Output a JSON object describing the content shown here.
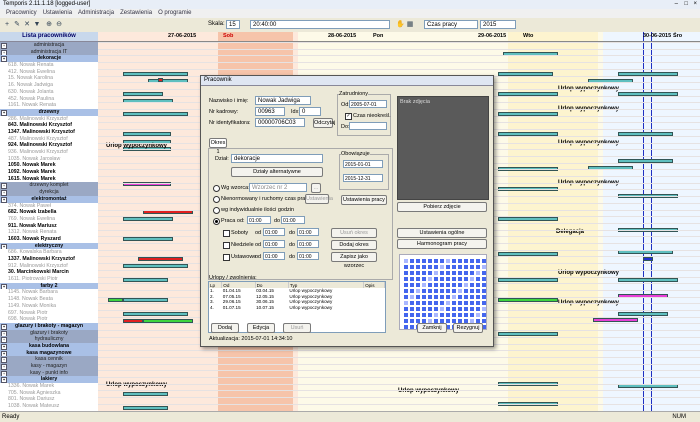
{
  "window": {
    "title": "Temporis 2.11.1.18 [logged-user]"
  },
  "menu": [
    "Pracownicy",
    "Ustawienia",
    "Administracja",
    "Zestawienia",
    "O programie"
  ],
  "toolbar": {
    "skala_label": "Skala:",
    "skala_value": "15",
    "time_value": "20:40:00",
    "view_select": "Czas pracy",
    "year_select": "2015"
  },
  "left_panel": {
    "header": "Lista pracowników",
    "rows": [
      {
        "type": "group",
        "text": "administracja"
      },
      {
        "type": "group",
        "text": "administracja IT"
      },
      {
        "type": "group-blue",
        "text": "dekoracje"
      },
      {
        "type": "dim",
        "text": "618. Nowak Renata"
      },
      {
        "type": "dim",
        "text": "412. Nowak Ewelina"
      },
      {
        "type": "dim",
        "text": "15. Nowak Karolina"
      },
      {
        "type": "dim",
        "text": "16. Nowak Jadwiga"
      },
      {
        "type": "dim",
        "text": "630. Nowak Jolanta"
      },
      {
        "type": "dim",
        "text": "452. Nowak Paulina"
      },
      {
        "type": "dim",
        "text": "1161. Nowak Renata"
      },
      {
        "type": "group-blue",
        "text": "drzewny"
      },
      {
        "type": "dim",
        "text": "286. Malinowski Krzysztof"
      },
      {
        "type": "bold",
        "text": "843. Malinowski Krzysztof"
      },
      {
        "type": "bold",
        "text": "1347. Malinowski Krzysztof"
      },
      {
        "type": "dim",
        "text": "487. Malinowski Krzysztof"
      },
      {
        "type": "bold",
        "text": "924. Malinowski Krzysztof"
      },
      {
        "type": "dim",
        "text": "936. Malinowski Krzysztof"
      },
      {
        "type": "dim",
        "text": "1035. Nowak Jarosław"
      },
      {
        "type": "bold",
        "text": "1050. Nowak Marek"
      },
      {
        "type": "bold",
        "text": "1092. Nowak Marek"
      },
      {
        "type": "bold",
        "text": "1615. Nowak Marek"
      },
      {
        "type": "group",
        "text": "drzewny komplet"
      },
      {
        "type": "group",
        "text": "dyrekcja"
      },
      {
        "type": "group-blue",
        "text": "elektromontaż"
      },
      {
        "type": "dim",
        "text": "374. Nowak Paweł"
      },
      {
        "type": "bold",
        "text": "682. Nowak Izabella"
      },
      {
        "type": "dim",
        "text": "769. Nowak Ewelina"
      },
      {
        "type": "bold",
        "text": "911. Nowak Mariusz"
      },
      {
        "type": "dim",
        "text": "1312. Nowak Renata"
      },
      {
        "type": "bold",
        "text": "1603. Nowak Ryszard"
      },
      {
        "type": "group-blue",
        "text": "elektryczny"
      },
      {
        "type": "dim",
        "text": "686. Kowalska Barbara"
      },
      {
        "type": "bold",
        "text": "1337. Malinowski Krzysztof"
      },
      {
        "type": "dim",
        "text": "912. Malinowski Krzysztof"
      },
      {
        "type": "bold",
        "text": "30. Marcinkowski Marcin"
      },
      {
        "type": "dim",
        "text": "1611. Piotrowski Piotr"
      },
      {
        "type": "group-blue",
        "text": "farby 2"
      },
      {
        "type": "dim",
        "text": "1145. Nowak Barbara"
      },
      {
        "type": "dim",
        "text": "1148. Nowak Beata"
      },
      {
        "type": "dim",
        "text": "1149. Nowak Monika"
      },
      {
        "type": "dim",
        "text": "697. Nowak Piotr"
      },
      {
        "type": "dim",
        "text": "698. Nowak Piotr"
      },
      {
        "type": "group-blue",
        "text": "glazury i brakoty - magazyn"
      },
      {
        "type": "group",
        "text": "glazury i brakoty"
      },
      {
        "type": "group",
        "text": "hydrauliczny"
      },
      {
        "type": "group-blue",
        "text": "kasa budowlana"
      },
      {
        "type": "group-blue",
        "text": "kasa magazynowe"
      },
      {
        "type": "group",
        "text": "kasa cennik"
      },
      {
        "type": "group",
        "text": "kasy - magazyn"
      },
      {
        "type": "group",
        "text": "kasy - punkt info"
      },
      {
        "type": "group-blue",
        "text": "lakiery"
      },
      {
        "type": "dim",
        "text": "1336. Nowak Marek"
      },
      {
        "type": "dim",
        "text": "705. Nowak Agnieszka"
      },
      {
        "type": "dim",
        "text": "801. Nowak Dariusz"
      },
      {
        "type": "dim",
        "text": "1038. Nowak Mateusz"
      }
    ]
  },
  "grid": {
    "days": [
      {
        "label": "27-06-2015",
        "sub": "Sob"
      },
      {
        "label": "28-06-2015",
        "sub": "Pon"
      },
      {
        "label": "29-06-2015",
        "sub": "Wto"
      },
      {
        "label": "30-06-2015",
        "sub": "Śro"
      }
    ],
    "annotations": [
      "Urlop wypoczynkowy",
      "Urlop wypoczynkowy",
      "Urlop wypoczynkowy",
      "Urlop wypoczynkowy",
      "Urlop wypoczynkowy",
      "Delegacja",
      "Urlop wypoczynkowy",
      "Urlop wypoczynkowy",
      "Urlop wypoczynkowy",
      "Urlop wypoczynkowy"
    ]
  },
  "dialog": {
    "title": "Pracownik",
    "surname_label": "Nazwisko i imię:",
    "surname_value": "Nowak Jadwiga",
    "nr_label": "Nr kadrowy:",
    "nr_value": "00963",
    "ido_label": "Idx:",
    "ido_value": "0",
    "nrid_label": "Nr identyfikatora:",
    "nrid_value": "00000706C03",
    "odczytaj": "Odczytaj",
    "zatrudniony": "Zatrudniony",
    "od_label": "Od:",
    "od_value": "2005-07-01",
    "czas_label": "Czas nieokreśl.",
    "do_label": "Do:",
    "tab": "Okres 1",
    "dzial_label": "Dział:",
    "dzial_value": "dekoracje",
    "dzialy_btn": "Działy alternatywne",
    "r1_label": "Wg wzorca:",
    "r1_value": "Wzorzec nr 2",
    "r2_label": "Nienormowany i ruchomy czas pracy",
    "r2_btn": "Ustawienia",
    "r3_label": "wg indywidualnie ilości godzin",
    "r4_label": "Praca od:",
    "r4_from": "01:00",
    "r4_to": "01:00",
    "sob_label": "Soboty",
    "niedz_label": "Niedziele",
    "swieta_label": "Ustawowe",
    "od_short": "od",
    "do_short": "do",
    "t_from": "01:00",
    "t_to": "01:00",
    "usun_btn": "Usuń okres",
    "dodaj_okres_btn": "Dodaj okres",
    "zapisz_btn": "Zapisz jako wzorzec",
    "obowiazuje": "Obowiązuje",
    "ob_from": "2015-01-01",
    "ob_to": "2015-12-31",
    "ustawienia_btn": "Ustawienia pracy",
    "zdjecie": "Brak zdjęcia",
    "pobierz_btn": "Pobierz zdjęcie",
    "ust_ogolne_btn": "Ustawienia ogólne",
    "harmonogram_btn": "Harmonogram pracy",
    "urlopy_label": "Urlopy / zwolnienia:",
    "table_headers": [
      "Lp",
      "Od",
      "Do",
      "Typ",
      "Opis"
    ],
    "table_rows": [
      [
        "1.",
        "01.04.15",
        "03.04.15",
        "Urlop wypoczynkowy",
        ""
      ],
      [
        "2.",
        "07.05.15",
        "12.05.15",
        "Urlop wypoczynkowy",
        ""
      ],
      [
        "3.",
        "29.06.15",
        "30.06.15",
        "Urlop wypoczynkowy",
        ""
      ],
      [
        "4.",
        "01.07.15",
        "10.07.15",
        "Urlop wypoczynkowy",
        ""
      ]
    ],
    "dodaj_btn": "Dodaj",
    "edycja_btn": "Edycja",
    "usun2_btn": "Usuń",
    "zamknij_btn": "Zamknij",
    "rezygnuj_btn": "Rezygnuj",
    "aktualizacja": "Aktualizacja: 2015-07-01 14:34:10"
  },
  "status": {
    "left": "Ready",
    "right": "NUM"
  }
}
